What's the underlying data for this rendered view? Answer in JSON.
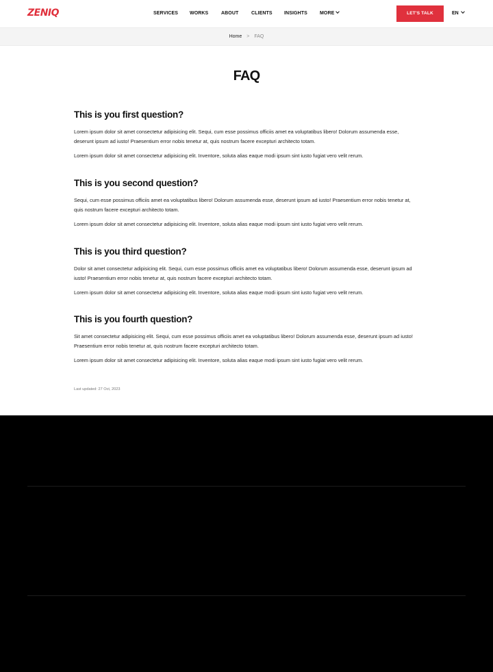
{
  "header": {
    "logo": "ZENIQ",
    "nav": [
      {
        "label": "SERVICES"
      },
      {
        "label": "WORKS"
      },
      {
        "label": "ABOUT"
      },
      {
        "label": "CLIENTS"
      },
      {
        "label": "INSIGHTS"
      },
      {
        "label": "MORE"
      }
    ],
    "cta_label": "LET'S TALK",
    "lang": "EN"
  },
  "breadcrumb": {
    "home": "Home",
    "separator": ">",
    "current": "FAQ"
  },
  "page": {
    "title": "FAQ",
    "items": [
      {
        "question": "This is you first question?",
        "p1": "Lorem ipsum dolor sit amet consectetur adipisicing elit. Sequi, cum esse possimus officiis amet ea voluptatibus libero! Dolorum assumenda esse, deserunt ipsum ad iusto! Praesentium error nobis tenetur at, quis nostrum facere excepturi architecto totam.",
        "p2": "Lorem ipsum dolor sit amet consectetur adipisicing elit. Inventore, soluta alias eaque modi ipsum sint iusto fugiat vero velit rerum."
      },
      {
        "question": "This is you second question?",
        "p1": "Sequi, cum esse possimus officiis amet ea voluptatibus libero! Dolorum assumenda esse, deserunt ipsum ad iusto! Praesentium error nobis tenetur at, quis nostrum facere excepturi architecto totam.",
        "p2": "Lorem ipsum dolor sit amet consectetur adipisicing elit. Inventore, soluta alias eaque modi ipsum sint iusto fugiat vero velit rerum."
      },
      {
        "question": "This is you third question?",
        "p1": "Dolor sit amet consectetur adipisicing elit. Sequi, cum esse possimus officiis amet ea voluptatibus libero! Dolorum assumenda esse, deserunt ipsum ad iusto! Praesentium error nobis tenetur at, quis nostrum facere excepturi architecto totam.",
        "p2": "Lorem ipsum dolor sit amet consectetur adipisicing elit. Inventore, soluta alias eaque modi ipsum sint iusto fugiat vero velit rerum."
      },
      {
        "question": "This is you fourth question?",
        "p1": "Sit amet consectetur adipisicing elit. Sequi, cum esse possimus officiis amet ea voluptatibus libero! Dolorum assumenda esse, deserunt ipsum ad iusto! Praesentium error nobis tenetur at, quis nostrum facere excepturi architecto totam.",
        "p2": "Lorem ipsum dolor sit amet consectetur adipisicing elit. Inventore, soluta alias eaque modi ipsum sint iusto fugiat vero velit rerum."
      }
    ],
    "last_updated": "Last updated: 27 Oct, 2023"
  },
  "colors": {
    "accent": "#e0313d",
    "footer_bg": "#000000",
    "breadcrumb_bg": "#f4f4f4"
  },
  "icons": {
    "more_chevron": "chevron-down-icon",
    "lang_chevron": "chevron-down-icon"
  }
}
